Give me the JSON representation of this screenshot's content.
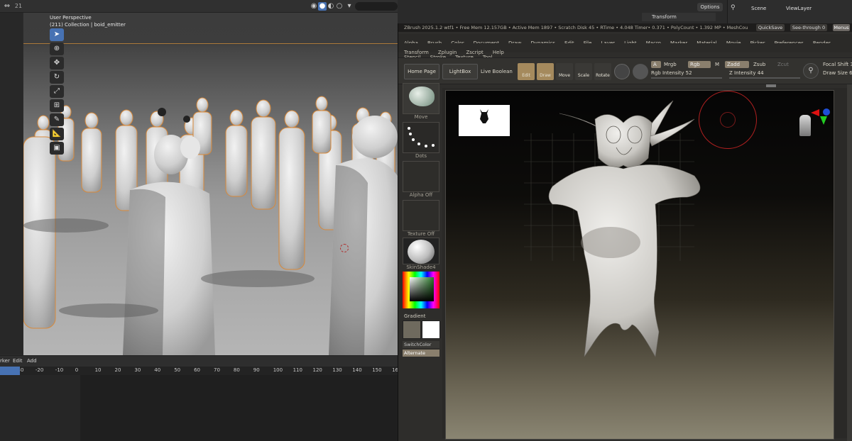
{
  "blender": {
    "view_title": "User Perspective",
    "view_subtitle": "(211) Collection | boid_emitter",
    "timeline_menus": [
      "rker",
      "Edit",
      "Add"
    ],
    "ruler_ticks": [
      "-30",
      "-20",
      "-10",
      "0",
      "10",
      "20",
      "30",
      "40",
      "50",
      "60",
      "70",
      "80",
      "90",
      "100",
      "110",
      "120",
      "130",
      "140",
      "150",
      "16"
    ],
    "options_label": "Options",
    "transform_label": "Transform",
    "scene_label": "Scene",
    "viewlayer_label": "ViewLayer",
    "frame_indicator": "21"
  },
  "zbrush": {
    "title": "ZBrush 2025.1.2   wtf1  •  Free Mem 12.157GB  •  Active Mem 1897  •  Scratch Disk 45  •  RTime • 4.048 Timer• 0.371  •  PolyCount • 1.392 MP  •  MeshCou",
    "quicksave": "QuickSave",
    "seethrough": "See-through  0",
    "menu_btn": "Menus",
    "menu_row1": [
      "Alpha",
      "Brush",
      "Color",
      "Document",
      "Draw",
      "Dynamics",
      "Edit",
      "File",
      "Layer",
      "Light",
      "Macro",
      "Marker",
      "Material",
      "Movie",
      "Picker",
      "Preferences",
      "Render",
      "Stencil",
      "Stroke",
      "Texture",
      "Tool"
    ],
    "menu_row2": [
      "Transform",
      "Zplugin",
      "Zscript",
      "Help"
    ],
    "home_page": "Home Page",
    "lightbox": "LightBox",
    "live_boolean": "Live Boolean",
    "mode_edit": "Edit",
    "mode_draw": "Draw",
    "mode_move": "Move",
    "mode_scale": "Scale",
    "mode_rotate": "Rotate",
    "a_label": "A",
    "mrgb": "Mrgb",
    "rgb": "Rgb",
    "m": "M",
    "zadd": "Zadd",
    "zsub": "Zsub",
    "zcut": "Zcut",
    "rgb_intensity": "Rgb Intensity 52",
    "z_intensity": "Z Intensity 44",
    "focal_shift": "Focal Shift 38",
    "draw_size": "Draw Size 64",
    "tray_move": "Move",
    "tray_dots": "Dots",
    "tray_alpha": "Alpha Off",
    "tray_texture": "Texture Off",
    "tray_material": "SkinShade4",
    "gradient": "Gradient",
    "switchcolor": "SwitchColor",
    "alternate": "Alternate"
  },
  "colors": {
    "blender_accent": "#4772b3",
    "selection_outline": "#e08a3a",
    "zbrush_active": "#a58a5d"
  }
}
